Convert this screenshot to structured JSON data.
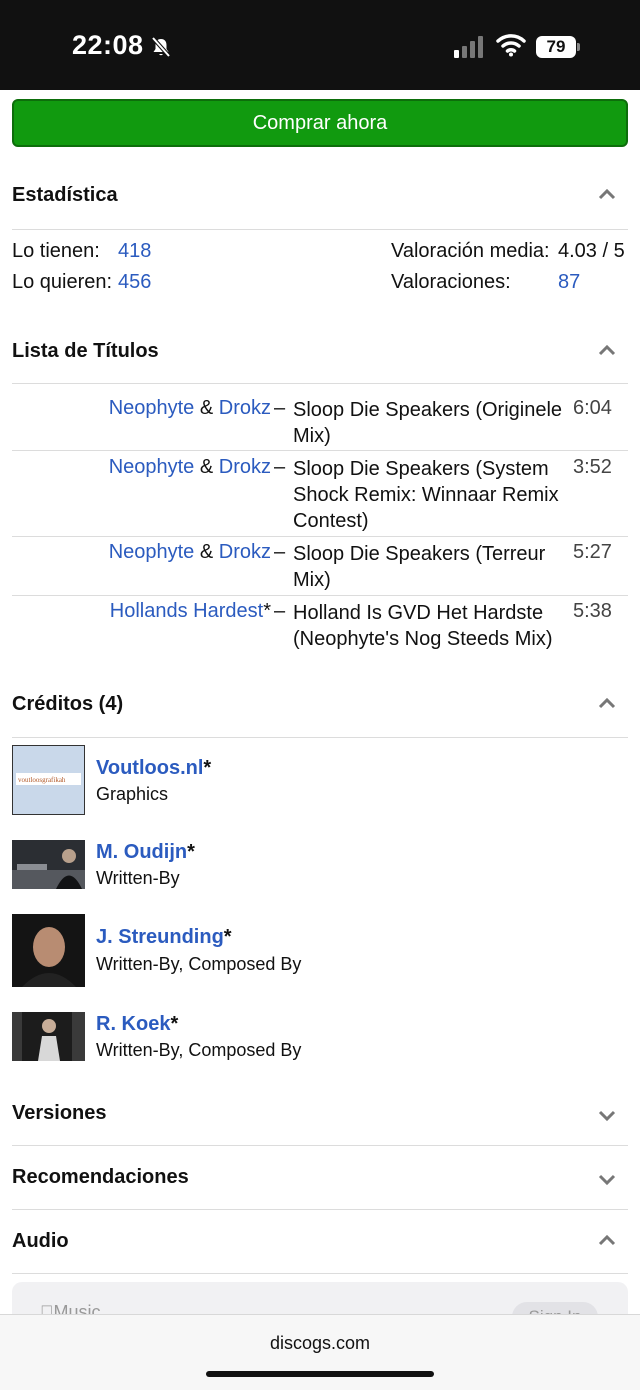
{
  "status_bar": {
    "time": "22:08",
    "battery": "79"
  },
  "buy_button": {
    "label": "Comprar ahora"
  },
  "stats": {
    "title": "Estadística",
    "have_label": "Lo tienen:",
    "have_value": "418",
    "want_label": "Lo quieren:",
    "want_value": "456",
    "avg_label": "Valoración media:",
    "avg_value": "4.03 / 5",
    "ratings_label": "Valoraciones:",
    "ratings_value": "87"
  },
  "tracklist": {
    "title": "Lista de Títulos",
    "tracks": [
      {
        "artist1": "Neophyte",
        "join": " & ",
        "artist2": "Drokz",
        "dash": "–",
        "title": "Sloop Die Speakers (Originele Mix)",
        "duration": "6:04"
      },
      {
        "artist1": "Neophyte",
        "join": " & ",
        "artist2": "Drokz",
        "dash": "–",
        "title": "Sloop Die Speakers (System Shock Remix: Winnaar Remix Contest)",
        "duration": "3:52"
      },
      {
        "artist1": "Neophyte",
        "join": " & ",
        "artist2": "Drokz",
        "dash": "–",
        "title": "Sloop Die Speakers (Terreur Mix)",
        "duration": "5:27"
      },
      {
        "artist1": "Hollands Hardest",
        "join": "*",
        "artist2": "",
        "dash": "–",
        "title": "Holland Is GVD Het Hardste (Neophyte's Nog Steeds Mix)",
        "duration": "5:38"
      }
    ]
  },
  "credits": {
    "title": "Créditos (4)",
    "items": [
      {
        "name": "Voutloos.nl",
        "star": "*",
        "role": "Graphics",
        "thumb_text": "voutloosgrafikah"
      },
      {
        "name": "M. Oudijn",
        "star": "*",
        "role": "Written-By"
      },
      {
        "name": "J. Streunding",
        "star": "*",
        "role": "Written-By, Composed By"
      },
      {
        "name": "R. Koek",
        "star": "*",
        "role": "Written-By, Composed By"
      }
    ]
  },
  "sections": {
    "versions": "Versiones",
    "recommendations": "Recomendaciones",
    "audio": "Audio"
  },
  "audio_card": {
    "service": "Music",
    "signin": "Sign In"
  },
  "browser": {
    "url": "discogs.com"
  },
  "colors": {
    "buy_green": "#119a0f",
    "link_blue": "#2b5bbf"
  }
}
